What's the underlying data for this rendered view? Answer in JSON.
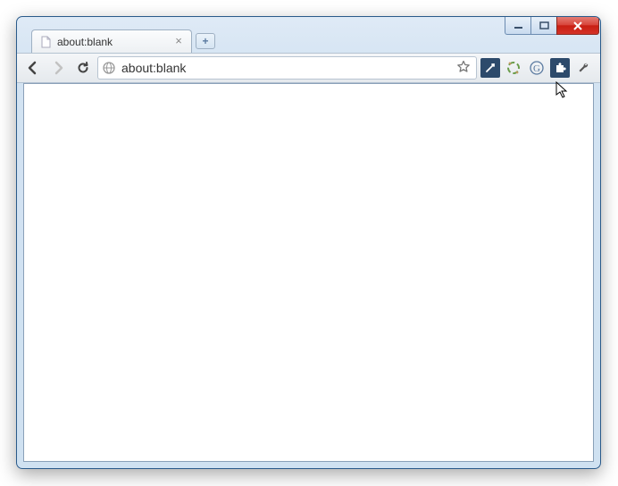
{
  "tab": {
    "title": "about:blank"
  },
  "address": {
    "url": "about:blank"
  },
  "icons": {
    "newtab": "+",
    "tabclose": "×"
  }
}
